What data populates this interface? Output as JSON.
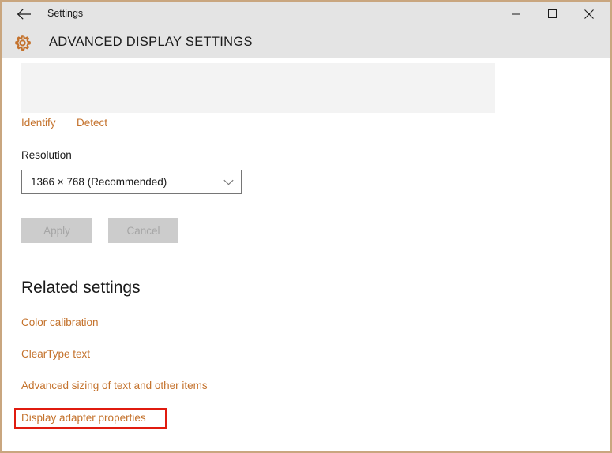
{
  "window": {
    "border_color": "#c9a67f",
    "background": "#ffffff"
  },
  "titlebar": {
    "back_icon": "back-arrow-icon",
    "app_title": "Settings",
    "minimize_icon": "minimize-icon",
    "maximize_icon": "maximize-icon",
    "close_icon": "close-icon",
    "background": "#e4e4e4"
  },
  "header": {
    "gear_icon": "gear-icon",
    "page_title": "ADVANCED DISPLAY SETTINGS",
    "accent_color": "#c4722c"
  },
  "main": {
    "display_preview": {
      "name": "display-preview-panel",
      "background": "#f3f3f3"
    },
    "identify_label": "Identify",
    "detect_label": "Detect",
    "resolution_label": "Resolution",
    "resolution_value": "1366 × 768 (Recommended)",
    "dropdown_chevron_icon": "chevron-down-icon",
    "apply_label": "Apply",
    "cancel_label": "Cancel",
    "buttons_disabled": true
  },
  "related_settings": {
    "heading": "Related settings",
    "links": [
      {
        "label": "Color calibration"
      },
      {
        "label": "ClearType text"
      },
      {
        "label": "Advanced sizing of text and other items"
      },
      {
        "label": "Display adapter properties",
        "highlighted": true
      }
    ]
  },
  "annotation": {
    "highlight_color": "#e01b0f",
    "target": "Display adapter properties"
  },
  "colors": {
    "link": "#c4722c",
    "text": "#1a1a1a",
    "chrome": "#e4e4e4",
    "disabled_button_bg": "#cccccc",
    "disabled_button_text": "#a6a6a6"
  }
}
